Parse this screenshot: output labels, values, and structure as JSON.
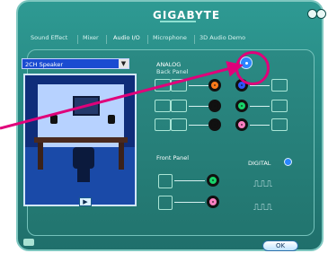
{
  "window": {
    "brand": "GIGABYTE",
    "buttons": {
      "minimize": "minimize-icon",
      "close": "close-icon"
    }
  },
  "tabs": [
    {
      "label": "Sound Effect"
    },
    {
      "label": "Mixer"
    },
    {
      "label": "Audio I/O"
    },
    {
      "label": "Microphone"
    },
    {
      "label": "3D Audio Demo"
    }
  ],
  "audio_io": {
    "speaker_select": {
      "value": "2CH Speaker"
    },
    "analog": {
      "title": "ANALOG",
      "subtitle": "Back Panel"
    },
    "front_panel": {
      "title": "Front Panel"
    },
    "digital": {
      "title": "DIGITAL"
    }
  },
  "footer": {
    "ok_label": "OK"
  },
  "colors": {
    "highlight_circle": "#e0007a",
    "window_teal": "#1f6f6b",
    "panel_teal": "#22756f",
    "jack_orange": "#ff7a1a",
    "jack_blue": "#2b55ff",
    "jack_black": "#111111",
    "jack_green": "#18d36a",
    "jack_pink": "#ff7fc2",
    "dropdown_blue": "#1a4bd1"
  }
}
